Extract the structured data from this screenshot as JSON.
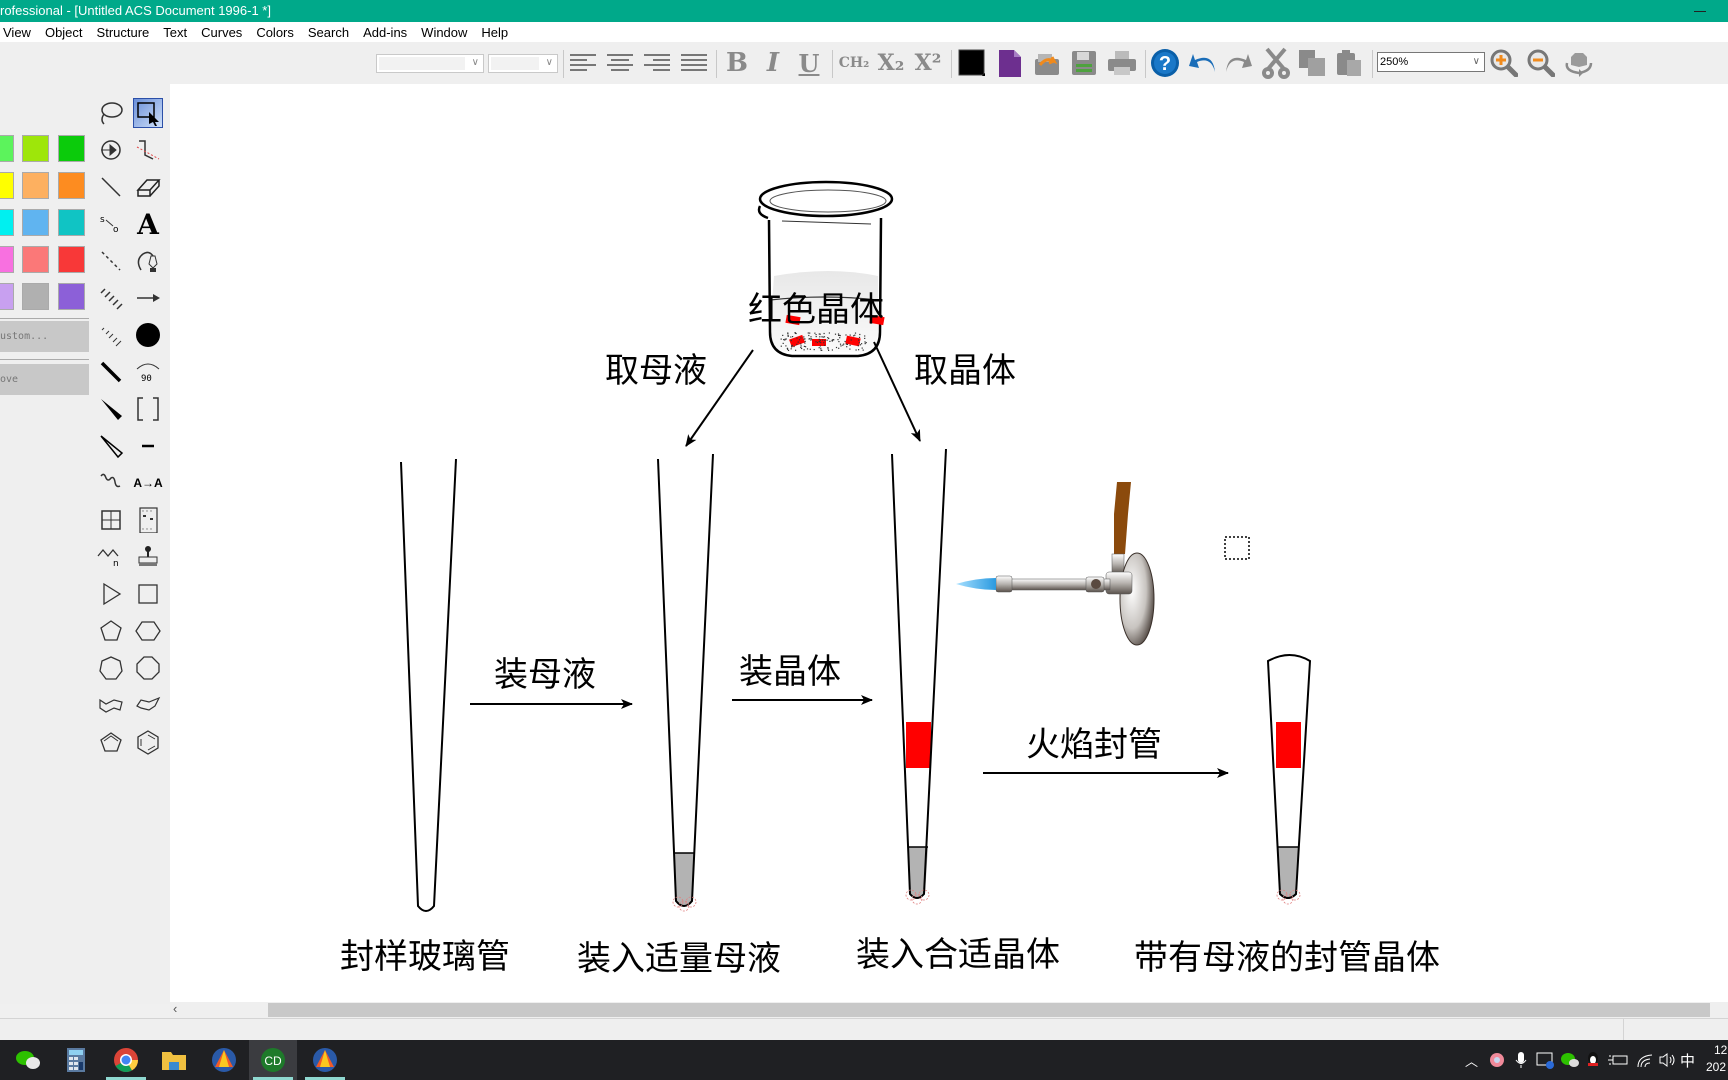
{
  "window": {
    "title": "rofessional - [Untitled ACS Document 1996-1 *]"
  },
  "menu": [
    "View",
    "Object",
    "Structure",
    "Text",
    "Curves",
    "Colors",
    "Search",
    "Add-ins",
    "Window",
    "Help"
  ],
  "toolbar": {
    "font_combo": "",
    "size_combo": "",
    "zoom_value": "250%",
    "buttons": [
      "align-left",
      "align-center",
      "align-right",
      "justify",
      "bold",
      "italic",
      "underline",
      "formula",
      "subscript",
      "superscript",
      "color",
      "new-document",
      "open",
      "save",
      "print",
      "help",
      "undo",
      "redo",
      "cut",
      "copy",
      "paste",
      "zoom-in",
      "zoom-out",
      "rotate-3d"
    ],
    "bold_label": "B",
    "italic_label": "I",
    "underline_label": "U",
    "formula_label": "CH₂",
    "subscript_label": "X₂",
    "superscript_label": "X²",
    "help_label": "?"
  },
  "palette": {
    "colors": [
      [
        "#5cf35c",
        "#9ee60a",
        "#0bcb0b"
      ],
      [
        "#ffff00",
        "#fdb060",
        "#fd8c20"
      ],
      [
        "#00f0f0",
        "#60b4f0",
        "#10c4c4"
      ],
      [
        "#f870e0",
        "#fb7878",
        "#f83838"
      ],
      [
        "#c8a0f0",
        "#b0b0b0",
        "#8c60d8"
      ]
    ],
    "custom_label": "ustom...",
    "remove_label": "ove"
  },
  "tools": {
    "text_tool_label": "A",
    "angle_label": "90",
    "replace_label": "A→A"
  },
  "document": {
    "beaker_label": "红色晶体",
    "take_mother_liquor": "取母液",
    "take_crystal": "取晶体",
    "load_mother_liquor": "装母液",
    "load_crystal": "装晶体",
    "flame_seal": "火焰封管",
    "captions": [
      "封样玻璃管",
      "装入适量母液",
      "装入合适晶体",
      "带有母液的封管晶体"
    ],
    "colors": {
      "crystal": "#ff0000",
      "liquor": "#b3b3b3",
      "hose": "#8b4a0c",
      "flame": "#3aa8e8"
    }
  },
  "taskbar": {
    "apps": [
      "wechat",
      "calculator",
      "chrome",
      "file-explorer",
      "app-1",
      "chemdraw",
      "app-2"
    ],
    "ime": "中",
    "clock_partial": "12",
    "date_partial": "202"
  }
}
